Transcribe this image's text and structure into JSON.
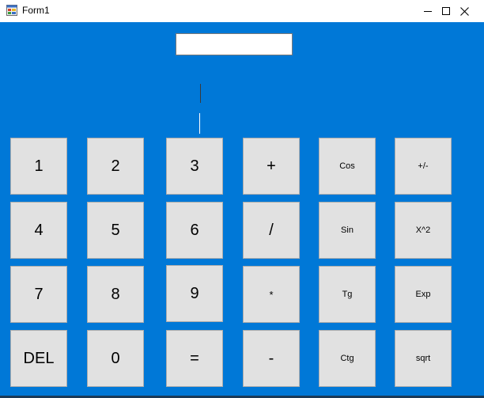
{
  "window": {
    "title": "Form1",
    "icon": "winforms-app-icon",
    "controls": [
      "minimize-icon",
      "maximize-icon",
      "close-icon"
    ]
  },
  "colors": {
    "client_background": "#0078d7",
    "button_face": "#e1e1e1",
    "button_border": "#adadad"
  },
  "display": {
    "input_value": ""
  },
  "keypad": {
    "rows": [
      [
        "1",
        "2",
        "3",
        "+",
        "Cos",
        "+/-"
      ],
      [
        "4",
        "5",
        "6",
        "/",
        "Sin",
        "X^2"
      ],
      [
        "7",
        "8",
        "9",
        "*",
        "Tg",
        "Exp"
      ],
      [
        "DEL",
        "0",
        "=",
        "-",
        "Ctg",
        "sqrt"
      ]
    ]
  }
}
